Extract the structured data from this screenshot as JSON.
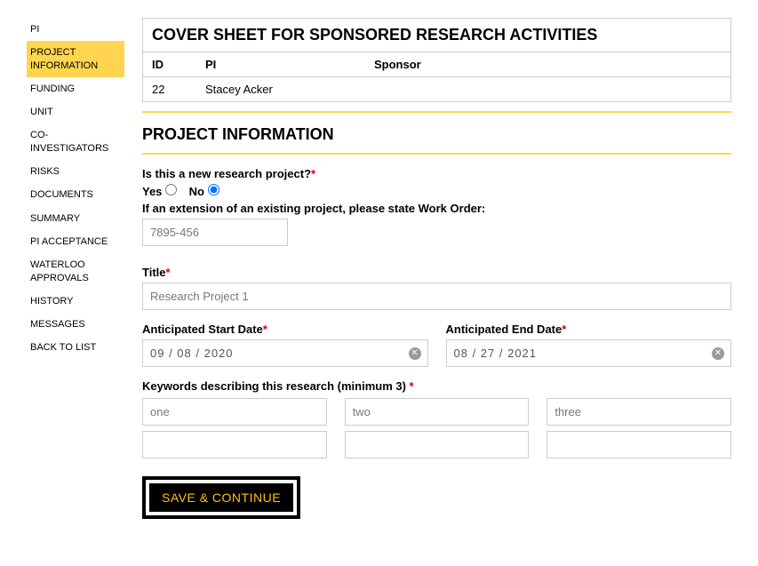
{
  "sidebar": {
    "items": [
      {
        "label": "PI"
      },
      {
        "label": "PROJECT INFORMATION"
      },
      {
        "label": "FUNDING"
      },
      {
        "label": "UNIT"
      },
      {
        "label": "CO-INVESTIGATORS"
      },
      {
        "label": "RISKS"
      },
      {
        "label": "DOCUMENTS"
      },
      {
        "label": "SUMMARY"
      },
      {
        "label": "PI ACCEPTANCE"
      },
      {
        "label": "WATERLOO APPROVALS"
      },
      {
        "label": "HISTORY"
      },
      {
        "label": "MESSAGES"
      },
      {
        "label": "BACK TO LIST"
      }
    ],
    "active_index": 1
  },
  "header": {
    "title": "COVER SHEET FOR SPONSORED RESEARCH ACTIVITIES",
    "cols": {
      "id": "ID",
      "pi": "PI",
      "sponsor": "Sponsor"
    },
    "row": {
      "id": "22",
      "pi": "Stacey Acker",
      "sponsor": ""
    }
  },
  "section": {
    "title": "PROJECT INFORMATION"
  },
  "form": {
    "new_project_label": "Is this a new research project?",
    "yes_label": "Yes",
    "no_label": "No",
    "new_project_value": "No",
    "work_order_label": "If an extension of an existing project, please state Work Order:",
    "work_order_value": "7895-456",
    "title_label": "Title",
    "title_value": "Research Project 1",
    "start_label": "Anticipated Start Date",
    "start_value": "09 / 08 / 2020",
    "end_label": "Anticipated End Date",
    "end_value": "08 / 27 / 2021",
    "keywords_label": "Keywords describing this research (minimum 3) ",
    "keywords": [
      "one",
      "two",
      "three",
      "",
      "",
      ""
    ],
    "save_label": "SAVE & CONTINUE"
  }
}
